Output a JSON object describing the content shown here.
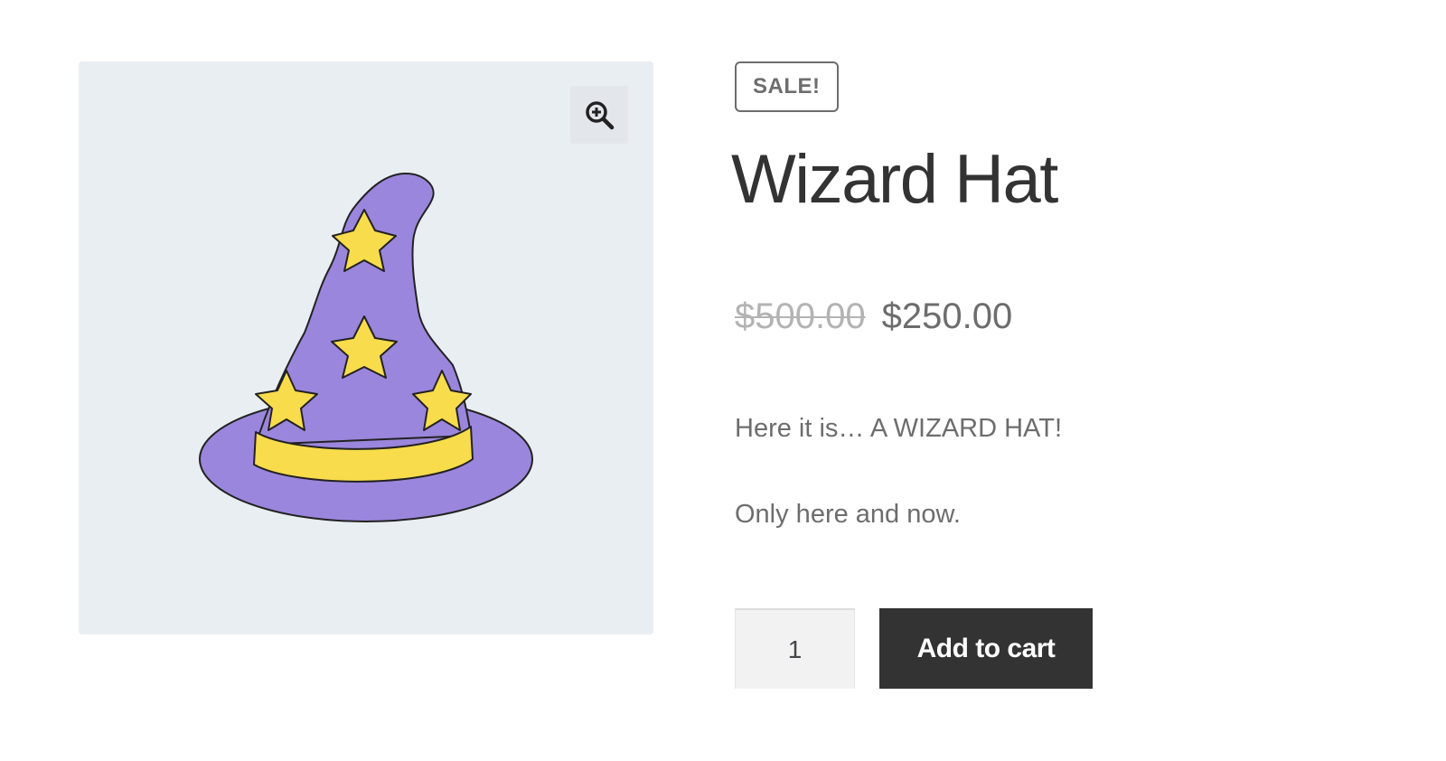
{
  "gallery": {
    "zoom_icon": "magnifier-zoom-icon",
    "image_subject": "wizard-hat-icon",
    "colors": {
      "background": "#e9eef2",
      "hat": "#9b86dd",
      "stars": "#f9dc4b",
      "outline": "#222222"
    }
  },
  "product": {
    "badge": "SALE!",
    "title": "Wizard Hat",
    "price_regular": "$500.00",
    "price_sale": "$250.00",
    "description": [
      "Here it is… A WIZARD HAT!",
      "Only here and now."
    ],
    "quantity": "1",
    "add_to_cart_label": "Add to cart"
  },
  "colors": {
    "button_bg": "#333333",
    "badge_border": "#6d6d6d",
    "old_price": "#b3b3b3",
    "text_muted": "#6d6d6d"
  }
}
